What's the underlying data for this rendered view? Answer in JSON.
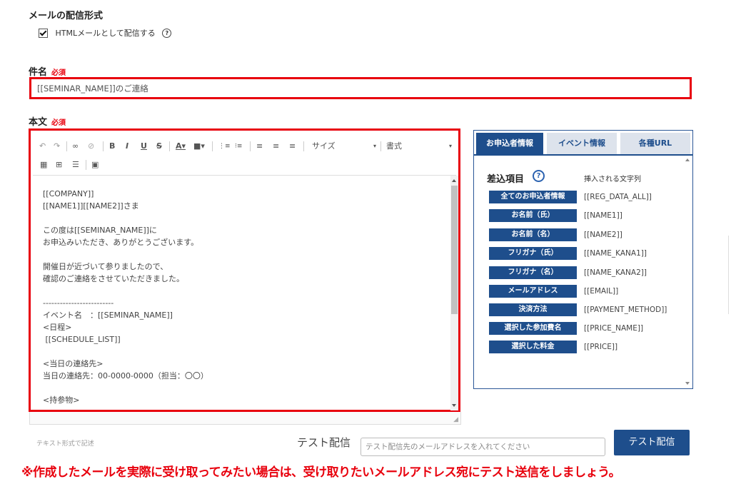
{
  "format_section": {
    "heading": "メールの配信形式",
    "html_checkbox_label": "HTMLメールとして配信する",
    "html_checked": true,
    "help_glyph": "?"
  },
  "subject": {
    "label": "件名",
    "required": "必須",
    "value": "[[SEMINAR_NAME]]のご連絡"
  },
  "body": {
    "label": "本文",
    "required": "必須",
    "toolbar": {
      "size_label": "サイズ",
      "format_label": "書式",
      "icons": [
        "undo-icon",
        "redo-icon",
        "link-icon",
        "unlink-icon",
        "bold-icon",
        "italic-icon",
        "underline-icon",
        "strikethrough-icon",
        "text-color-icon",
        "bg-color-icon",
        "numbered-list-icon",
        "bulleted-list-icon",
        "align-left-icon",
        "align-center-icon",
        "align-right-icon",
        "size-select",
        "format-select",
        "template-icon",
        "table-icon",
        "horizontal-rule-icon",
        "image-icon"
      ]
    },
    "lines": [
      "[[COMPANY]]",
      "[[NAME1]][[NAME2]]さま",
      "",
      "この度は[[SEMINAR_NAME]]に",
      "お申込みいただき、ありがとうございます。",
      "",
      "開催日が近づいて参りましたので、",
      "確認のご連絡をさせていただきました。",
      "",
      "-------------------------",
      "イベント名　：[[SEMINAR_NAME]]",
      "<日程>",
      " [[SCHEDULE_LIST]]",
      "",
      "<当日の連絡先>",
      "当日の連絡先：00-0000-0000（担当：〇〇）",
      "",
      "<持参物>"
    ]
  },
  "insert_panel": {
    "tabs": [
      "お申込者情報",
      "イベント情報",
      "各種URL"
    ],
    "active_tab": 0,
    "title": "差込項目",
    "column_header": "挿入される文字列",
    "items": [
      {
        "button": "全てのお申込者情報",
        "value": "[[REG_DATA_ALL]]"
      },
      {
        "button": "お名前（氏）",
        "value": "[[NAME1]]"
      },
      {
        "button": "お名前（名）",
        "value": "[[NAME2]]"
      },
      {
        "button": "フリガナ（氏）",
        "value": "[[NAME_KANA1]]"
      },
      {
        "button": "フリガナ（名）",
        "value": "[[NAME_KANA2]]"
      },
      {
        "button": "メールアドレス",
        "value": "[[EMAIL]]"
      },
      {
        "button": "決済方法",
        "value": "[[PAYMENT_METHOD]]"
      },
      {
        "button": "選択した参加費名",
        "value": "[[PRICE_NAME]]"
      },
      {
        "button": "選択した料金",
        "value": "[[PRICE]]"
      }
    ]
  },
  "footer": {
    "text_format_note": "テキスト形式で記述",
    "test_label": "テスト配信",
    "test_input_placeholder": "テスト配信先のメールアドレスを入れてください",
    "test_button": "テスト配信"
  },
  "annotation": "※作成したメールを実際に受け取ってみたい場合は、受け取りたいメールアドレス宛にテスト送信をしましょう。",
  "colors": {
    "accent_red": "#e8000d",
    "primary_blue": "#1e4e8c"
  }
}
